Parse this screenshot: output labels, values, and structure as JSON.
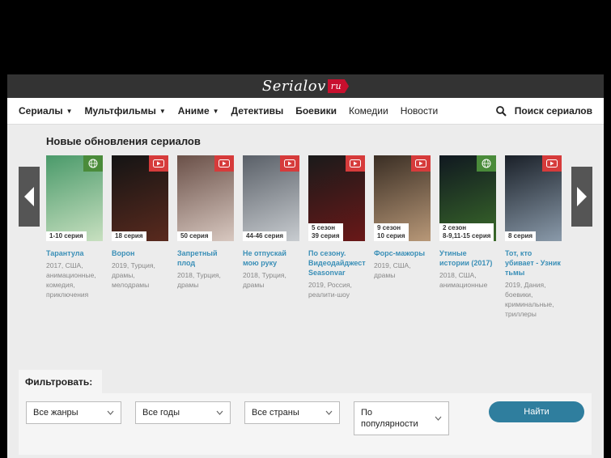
{
  "site": {
    "logo_main": "Serialov",
    "logo_ru": "ru"
  },
  "nav": [
    {
      "label": "Сериалы",
      "dropdown": true,
      "bold": true
    },
    {
      "label": "Мультфильмы",
      "dropdown": true,
      "bold": true
    },
    {
      "label": "Аниме",
      "dropdown": true,
      "bold": true
    },
    {
      "label": "Детективы",
      "dropdown": false,
      "bold": true
    },
    {
      "label": "Боевики",
      "dropdown": false,
      "bold": true
    },
    {
      "label": "Комедии",
      "dropdown": false,
      "bold": false
    },
    {
      "label": "Новости",
      "dropdown": false,
      "bold": false
    }
  ],
  "search": {
    "label": "Поиск сериалов",
    "icon": "search-icon"
  },
  "updates": {
    "title": "Новые обновления сериалов",
    "cards": [
      {
        "title": "Тарантула",
        "episodes": "1-10 серия",
        "meta": "2017, США, анимационные, комедия, приключения",
        "badge": "globe",
        "colors": [
          "#4a9a6a",
          "#c8e0c0"
        ]
      },
      {
        "title": "Ворон",
        "episodes": "18 серия",
        "meta": "2019, Турция, драмы, мелодрамы",
        "badge": "yt",
        "colors": [
          "#141414",
          "#5a2a1e"
        ]
      },
      {
        "title": "Запретный плод",
        "episodes": "50 серия",
        "meta": "2018, Турция, драмы",
        "badge": "yt",
        "colors": [
          "#6a5048",
          "#d8c8c0"
        ]
      },
      {
        "title": "Не отпускай мою руку",
        "episodes": "44-46 серия",
        "meta": "2018, Турция, драмы",
        "badge": "yt",
        "colors": [
          "#5a6068",
          "#c8ccd0"
        ]
      },
      {
        "title": "По сезону. Видеодайджест Seasonvar",
        "episodes": "5 сезон\n39 серия",
        "meta": "2019, Россия, реалити-шоу",
        "badge": "yt",
        "colors": [
          "#1a1a1a",
          "#6a1818"
        ]
      },
      {
        "title": "Форс-мажоры",
        "episodes": "9 сезон\n10 серия",
        "meta": "2019, США, драмы",
        "badge": "yt",
        "colors": [
          "#3a2e24",
          "#b89878"
        ]
      },
      {
        "title": "Утиные истории (2017)",
        "episodes": "2 сезон\n8-9,11-15 серия",
        "meta": "2018, США, анимационные",
        "badge": "globe",
        "colors": [
          "#101820",
          "#3a6a2a"
        ]
      },
      {
        "title": "Тот, кто убивает - Узник тьмы",
        "episodes": "8 серия",
        "meta": "2019, Дания, боевики, криминальные, триллеры",
        "badge": "yt",
        "colors": [
          "#1a2028",
          "#8a9aaa"
        ]
      }
    ]
  },
  "filter": {
    "tab_label": "Фильтровать:",
    "selects": [
      {
        "label": "Все жанры"
      },
      {
        "label": "Все годы"
      },
      {
        "label": "Все страны"
      },
      {
        "label": "По популярности"
      }
    ],
    "find_label": "Найти"
  },
  "colors": {
    "accent_link": "#3a8fb7",
    "button": "#2f7e9e",
    "yt_badge": "#d63b3b",
    "globe_badge": "#4a8b3a"
  }
}
